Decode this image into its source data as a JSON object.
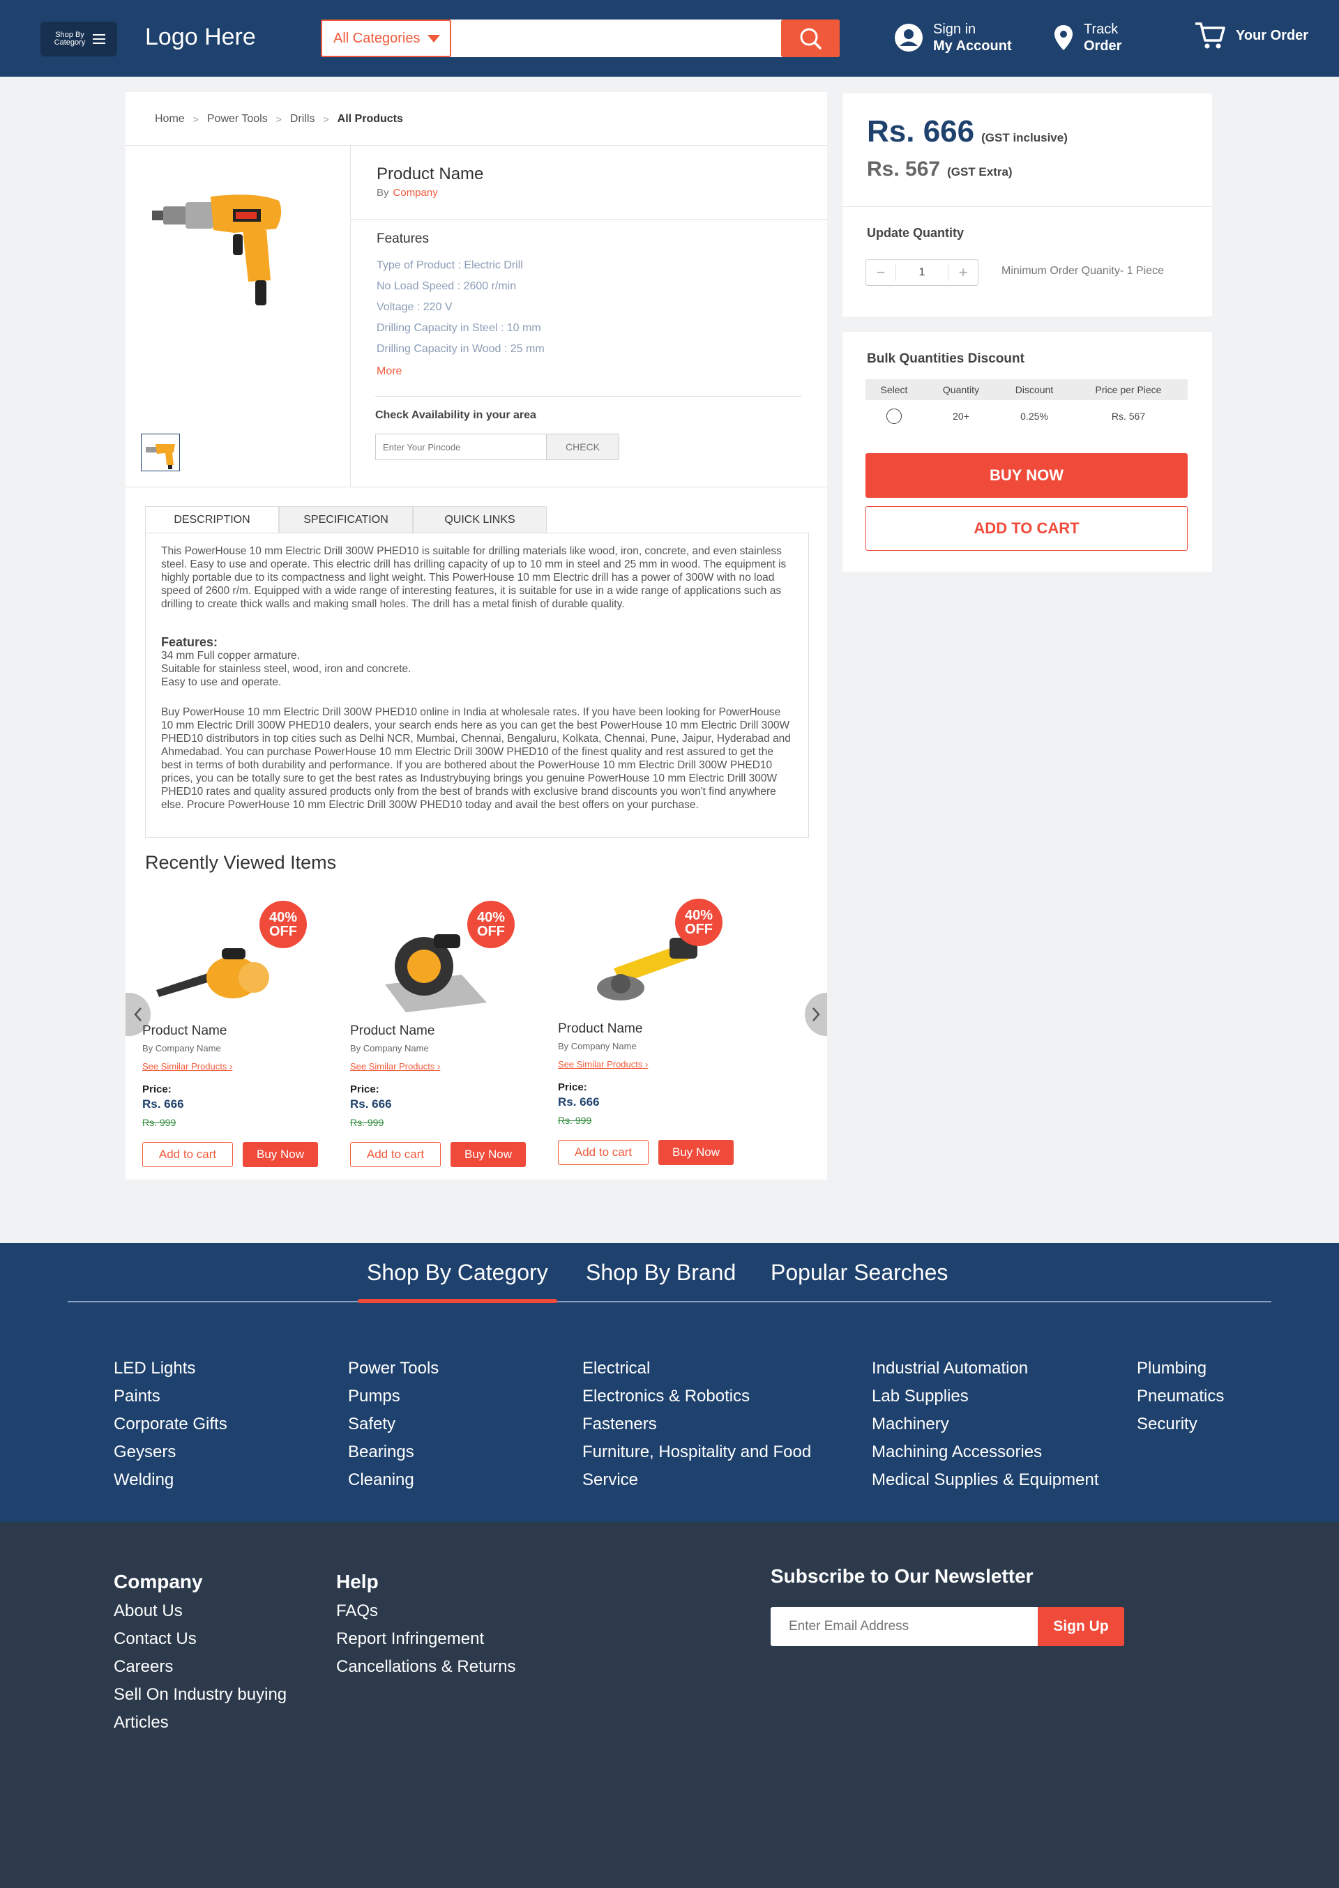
{
  "header": {
    "shop_by_category": "Shop By Category",
    "logo": "Logo Here",
    "category_select": "All Categories",
    "search_placeholder": "",
    "signin_line1": "Sign in",
    "signin_line2": "My Account",
    "track_line1": "Track",
    "track_line2": "Order",
    "order": "Your Order"
  },
  "breadcrumb": [
    "Home",
    "Power Tools",
    "Drills",
    "All Products"
  ],
  "product": {
    "name": "Product Name",
    "by": "By",
    "company": "Company",
    "features_title": "Features",
    "features": [
      "Type of Product :  Electric Drill",
      "No Load Speed :   2600 r/min",
      "Voltage : 220 V",
      "Drilling Capacity in Steel :    10 mm",
      "Drilling Capacity in Wood :  25 mm"
    ],
    "more": "More",
    "availability_title": "Check Availability in your area",
    "pincode_placeholder": "Enter Your Pincode",
    "check": "CHECK"
  },
  "tabs": [
    "DESCRIPTION",
    "SPECIFICATION",
    "QUICK LINKS"
  ],
  "description": {
    "para1": "This PowerHouse 10 mm Electric Drill 300W PHED10 is suitable for drilling materials like wood, iron, concrete, and even stainless steel. Easy to use and operate. This electric drill has drilling capacity of up to 10 mm in steel and 25 mm in wood. The equipment is highly portable due to its compactness and light weight. This PowerHouse 10 mm Electric drill has a power of 300W with no load speed of 2600 r/m. Equipped with a wide range of interesting features, it is suitable for use in a wide range of applications such as drilling to create thick walls and making small holes. The drill has a metal finish of durable quality.",
    "features_heading": "Features:",
    "features": [
      "34 mm Full copper armature.",
      "Suitable for stainless steel, wood, iron and concrete.",
      "Easy to use and operate."
    ],
    "para2": "Buy PowerHouse 10 mm Electric Drill 300W PHED10 online in India at wholesale rates. If you have been looking for PowerHouse 10 mm Electric Drill 300W PHED10 dealers, your search ends here as you can get the best PowerHouse 10 mm Electric Drill 300W PHED10 distributors in top cities such as Delhi NCR, Mumbai, Chennai, Bengaluru, Kolkata, Chennai, Pune, Jaipur, Hyderabad and Ahmedabad. You can purchase PowerHouse 10 mm Electric Drill 300W PHED10 of the finest quality and rest assured to get the best in terms of both durability and performance. If you are bothered about the PowerHouse 10 mm Electric Drill 300W PHED10 prices, you can be totally sure to get the best rates as Industrybuying brings you genuine PowerHouse 10 mm Electric Drill 300W PHED10 rates and quality assured products only from the best of brands with exclusive brand discounts you won't find anywhere else. Procure PowerHouse 10 mm Electric Drill 300W PHED10 today and avail the best offers on your purchase."
  },
  "recent": {
    "title": "Recently Viewed Items",
    "items": [
      {
        "badge1": "40%",
        "badge2": "OFF",
        "name": "Product Name",
        "by": "By",
        "company": "Company Name",
        "similar": "See Similar Products",
        "price_label": "Price:",
        "price": "Rs. 666",
        "old_price": "Rs. 999",
        "cart": "Add to cart",
        "buy": "Buy Now"
      },
      {
        "badge1": "40%",
        "badge2": "OFF",
        "name": "Product Name",
        "by": "By",
        "company": "Company Name",
        "similar": "See Similar Products",
        "price_label": "Price:",
        "price": "Rs. 666",
        "old_price": "Rs. 999",
        "cart": "Add to cart",
        "buy": "Buy Now"
      },
      {
        "badge1": "40%",
        "badge2": "OFF",
        "name": "Product Name",
        "by": "By",
        "company": "Company Name",
        "similar": "See Similar Products",
        "price_label": "Price:",
        "price": "Rs. 666",
        "old_price": "Rs. 999",
        "cart": "Add to cart",
        "buy": "Buy Now"
      }
    ]
  },
  "pricing": {
    "main_price": "Rs. 666",
    "main_note": "(GST inclusive)",
    "sub_price": "Rs. 567",
    "sub_note": "(GST Extra)",
    "update_qty": "Update Quantity",
    "qty_minus": "−",
    "qty_value": "1",
    "qty_plus": "+",
    "min_order": "Minimum Order Quanity- 1 Piece"
  },
  "bulk": {
    "title": "Bulk Quantities Discount",
    "headers": [
      "Select",
      "Quantity",
      "Discount",
      "Price per Piece"
    ],
    "row": {
      "quantity": "20+",
      "discount": "0.25%",
      "price": "Rs. 567"
    },
    "buy_now": "BUY NOW",
    "add_to_cart": "ADD TO CART"
  },
  "footer_categories": {
    "tabs": [
      "Shop By Category",
      "Shop By Brand",
      "Popular Searches"
    ],
    "col1": [
      "LED Lights",
      "Paints",
      "Corporate Gifts",
      "Geysers",
      "Welding"
    ],
    "col2": [
      "Power Tools",
      "Pumps",
      "Safety",
      "Bearings",
      "Cleaning"
    ],
    "col3": [
      "Electrical",
      "Electronics & Robotics",
      "Fasteners",
      "Furniture, Hospitality and Food",
      "Service"
    ],
    "col4": [
      "Industrial Automation",
      "Lab Supplies",
      "Machinery",
      "Machining Accessories",
      "Medical Supplies & Equipment"
    ],
    "col5": [
      "Plumbing",
      "Pneumatics",
      "Security"
    ]
  },
  "footer": {
    "company_title": "Company",
    "company_links": [
      "About Us",
      "Contact Us",
      "Careers",
      "Sell On Industry buying",
      "Articles"
    ],
    "help_title": "Help",
    "help_links": [
      "FAQs",
      "Report Infringement",
      "Cancellations & Returns"
    ],
    "newsletter_title": "Subscribe to Our Newsletter",
    "email_placeholder": "Enter Email Address",
    "signup": "Sign Up"
  },
  "colors": {
    "primary": "#1e416d",
    "accent": "#ef4a3a",
    "footer_dark": "#2c3a4c"
  }
}
